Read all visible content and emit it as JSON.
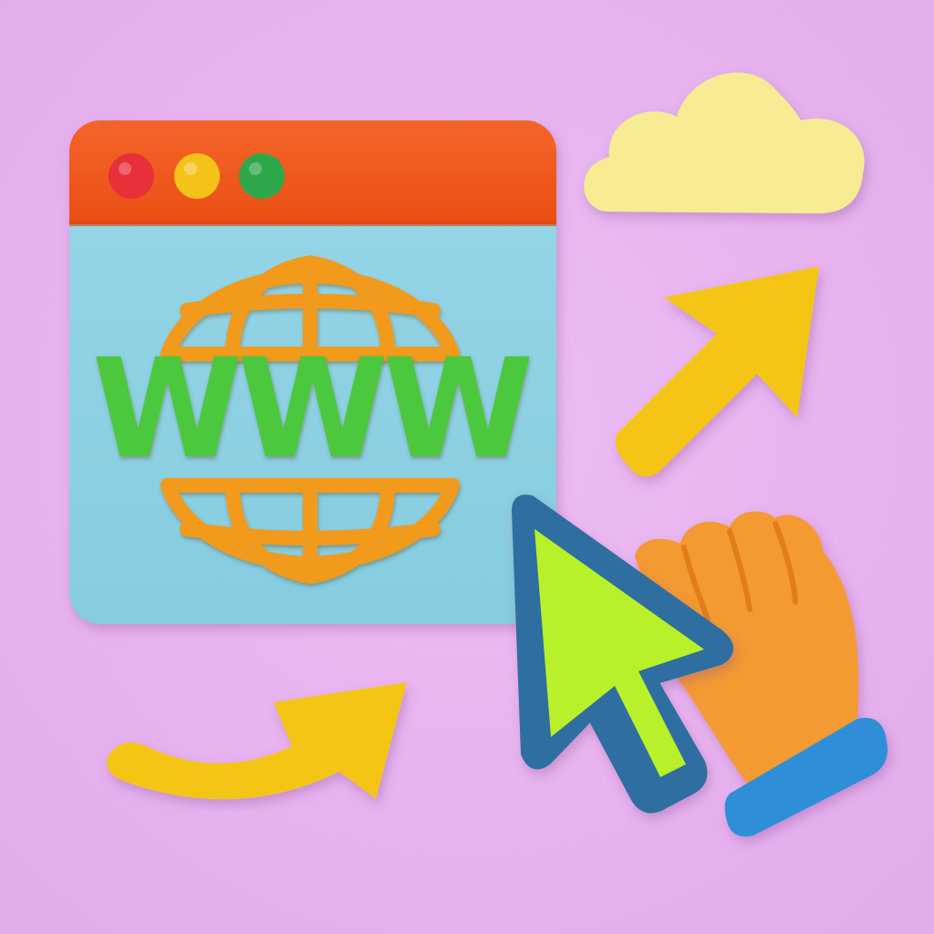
{
  "illustration": {
    "browser_window": {
      "traffic_lights": [
        "close-dot",
        "minimize-dot",
        "maximize-dot"
      ],
      "content_text": "WWW",
      "icon": "globe-icon"
    },
    "decorations": [
      "cloud-icon",
      "arrow-up-right-icon",
      "curved-arrow-icon",
      "cursor-arrow-icon",
      "hand-icon"
    ]
  },
  "colors": {
    "background": "#e9b4f0",
    "titlebar": "#f2561d",
    "window_body": "#8fd3e4",
    "dot_red": "#e8303a",
    "dot_yellow": "#f5c21a",
    "dot_green": "#2ca84a",
    "globe": "#f29a1e",
    "www_text": "#4cc83c",
    "cloud": "#f7ec93",
    "arrow": "#f5c518",
    "cursor_fill": "#b8f02a",
    "cursor_outline": "#2e6ea0",
    "hand": "#f39a30",
    "cuff": "#2f8fd8"
  }
}
